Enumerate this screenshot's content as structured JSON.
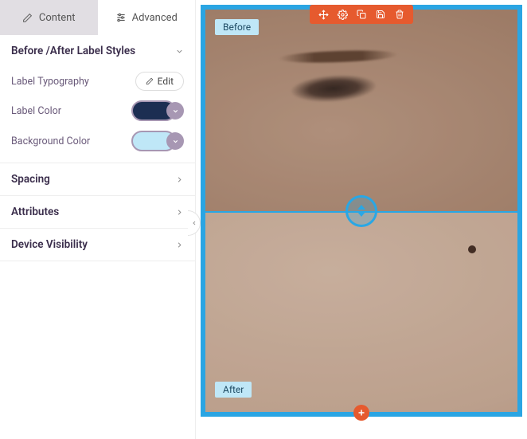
{
  "tabs": {
    "content": "Content",
    "advanced": "Advanced"
  },
  "sections": {
    "label_styles": {
      "title": "Before /After Label Styles",
      "typography_label": "Label Typography",
      "edit_label": "Edit",
      "label_color_label": "Label Color",
      "label_color_value": "#1c2e52",
      "background_color_label": "Background Color",
      "background_color_value": "#bfe7f7"
    },
    "spacing": {
      "title": "Spacing"
    },
    "attributes": {
      "title": "Attributes"
    },
    "device_visibility": {
      "title": "Device Visibility"
    }
  },
  "preview": {
    "before_label": "Before",
    "after_label": "After",
    "frame_color": "#2aa5e3",
    "toolbar_color": "#e65a2e"
  }
}
